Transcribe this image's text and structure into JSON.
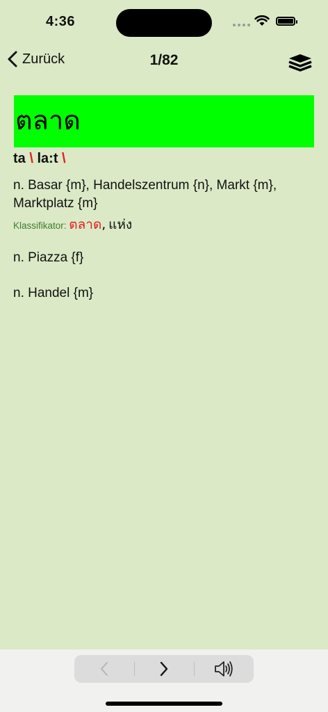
{
  "status_bar": {
    "time": "4:36"
  },
  "nav": {
    "back_label": "Zurück",
    "counter": "1/82",
    "layers_icon": "layers-icon"
  },
  "entry": {
    "headword": "ตลาด",
    "headword_bg": "#00ff00",
    "pronunciation": {
      "syllable1": "ta",
      "syllable2": "la:t",
      "separator": "\\"
    },
    "definitions": [
      "n. Basar {m}, Handelszentrum {n}, Markt {m}, Marktplatz {m}",
      "n. Piazza {f}",
      "n. Handel {m}"
    ],
    "classifier": {
      "label": "Klassifikator:",
      "word1": "ตลาด",
      "comma": ",",
      "word2": "แห่ง"
    }
  },
  "toolbar": {
    "prev_icon": "chevron-left-icon",
    "next_icon": "chevron-right-icon",
    "speaker_icon": "speaker-icon"
  },
  "colors": {
    "background": "#dbe9c6",
    "accent_red": "#e02020",
    "classifier_green": "#3d7d2e"
  }
}
